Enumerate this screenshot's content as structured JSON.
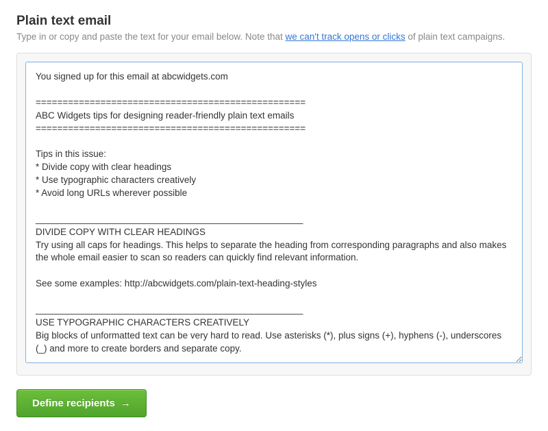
{
  "header": {
    "title": "Plain text email",
    "subheading_prefix": "Type in or copy and paste the text for your email below. Note that ",
    "subheading_link": "we can't track opens or clicks",
    "subheading_suffix": " of plain text campaigns."
  },
  "editor": {
    "content": "You signed up for this email at abcwidgets.com\n\n==================================================\nABC Widgets tips for designing reader-friendly plain text emails\n==================================================\n\nTips in this issue:\n* Divide copy with clear headings\n* Use typographic characters creatively\n* Avoid long URLs wherever possible\n\n____________________________________________________\nDIVIDE COPY WITH CLEAR HEADINGS\nTry using all caps for headings. This helps to separate the heading from corresponding paragraphs and also makes the whole email easier to scan so readers can quickly find relevant information.\n\nSee some examples: http://abcwidgets.com/plain-text-heading-styles\n\n____________________________________________________\nUSE TYPOGRAPHIC CHARACTERS CREATIVELY\nBig blocks of unformatted text can be very hard to read. Use asterisks (*), plus signs (+), hyphens (-), underscores (_) and more to create borders and separate copy.\n\nRead more: http://abcwidgets.com/typographic-tips"
  },
  "actions": {
    "define_recipients_label": "Define recipients",
    "arrow_glyph": "→"
  }
}
